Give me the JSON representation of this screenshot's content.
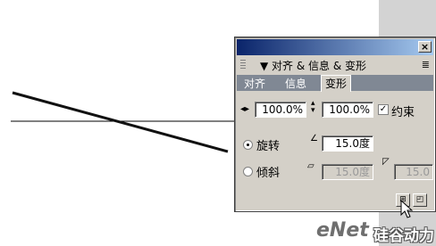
{
  "panel": {
    "title": "▼ 对齐 & 信息 & 变形",
    "close_label": "×",
    "tabs": [
      {
        "label": "对齐",
        "active": false
      },
      {
        "label": "信息",
        "active": false
      },
      {
        "label": "变形",
        "active": true
      }
    ],
    "scale": {
      "width_value": "100.0%",
      "height_value": "100.0%",
      "constrain_label": "约束",
      "constrain_checked": true
    },
    "rotate": {
      "label": "旋转",
      "value": "15.0度",
      "selected": true
    },
    "skew": {
      "label": "倾斜",
      "horizontal_value": "15.0度",
      "vertical_value": "15.0",
      "selected": false
    }
  },
  "watermark": {
    "text": "eNet",
    "cn_text": "硅谷动力"
  },
  "colors": {
    "panel_bg": "#d4d0c8",
    "title_gradient_start": "#0a246a",
    "title_gradient_end": "#a6caf0",
    "tabbar_bg": "#808894",
    "side_strip": "#d3d3d3"
  },
  "icons": {
    "scale_width": "horizontal-arrows-icon",
    "scale_height": "vertical-arrows-icon",
    "rotate": "rotate-angle-icon",
    "skew_h": "skew-horizontal-icon",
    "skew_v": "skew-vertical-icon",
    "copy_transform": "copy-transform-icon",
    "reset_transform": "reset-transform-icon",
    "cursor": "mouse-pointer-icon"
  }
}
